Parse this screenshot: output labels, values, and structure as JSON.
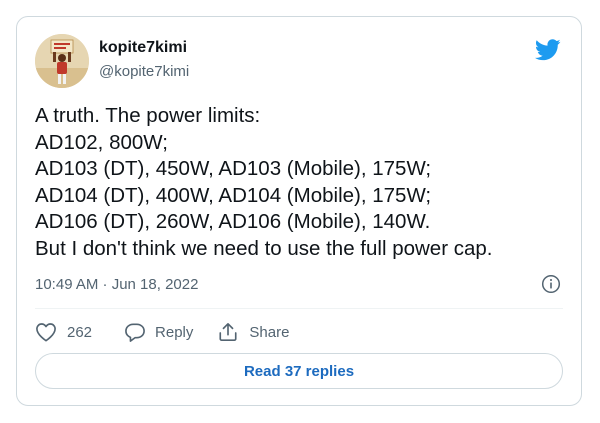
{
  "author": {
    "display_name": "kopite7kimi",
    "handle": "@kopite7kimi",
    "avatar_icon": "avatar-person-holding-sign"
  },
  "brand": {
    "icon": "twitter-bird-icon",
    "color": "#1d9bf0"
  },
  "tweet": {
    "lines": [
      "A truth. The power limits:",
      "AD102, 800W;",
      "AD103 (DT), 450W, AD103 (Mobile), 175W;",
      "AD104 (DT), 400W, AD104 (Mobile), 175W;",
      "AD106 (DT), 260W, AD106 (Mobile), 140W.",
      "But I don't think we need to use the full power cap."
    ],
    "timestamp": "10:49 AM · Jun 18, 2022",
    "info_icon": "info-icon"
  },
  "actions": {
    "like_count": "262",
    "reply_label": "Reply",
    "share_label": "Share"
  },
  "read_replies_label": "Read 37 replies",
  "colors": {
    "text": "#0f1419",
    "secondary": "#536471",
    "border": "#cfd9de",
    "link": "#1d6bbf"
  }
}
